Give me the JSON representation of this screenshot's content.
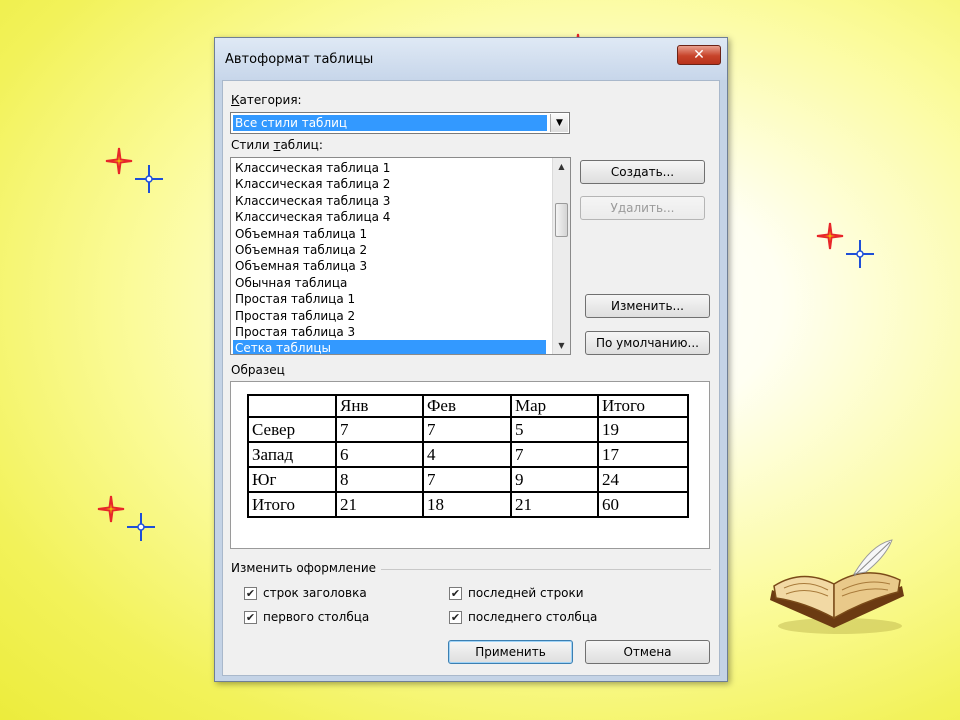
{
  "window": {
    "title": "Автоформат таблицы",
    "close_label": "✕"
  },
  "category": {
    "label_before": "",
    "label_underlined": "К",
    "label_after": "атегория:",
    "selected": "Все стили таблиц"
  },
  "styles": {
    "label_before": "Стили ",
    "label_underlined": "т",
    "label_after": "аблиц:",
    "items": [
      "Классическая таблица 1",
      "Классическая таблица 2",
      "Классическая таблица 3",
      "Классическая таблица 4",
      "Объемная таблица 1",
      "Объемная таблица 2",
      "Объемная таблица 3",
      "Обычная таблица",
      "Простая таблица 1",
      "Простая таблица 2",
      "Простая таблица 3",
      "Сетка таблицы"
    ],
    "selected_index": 11
  },
  "buttons": {
    "create": "Создать...",
    "delete": "Удалить...",
    "modify": "Изменить...",
    "default": "По умолчанию...",
    "apply": "Применить",
    "cancel": "Отмена"
  },
  "sample": {
    "label": "Образец",
    "header": [
      "",
      "Янв",
      "Фев",
      "Мар",
      "Итого"
    ],
    "rows": [
      [
        "Север",
        "7",
        "7",
        "5",
        "19"
      ],
      [
        "Запад",
        "6",
        "4",
        "7",
        "17"
      ],
      [
        "Юг",
        "8",
        "7",
        "9",
        "24"
      ],
      [
        "Итого",
        "21",
        "18",
        "21",
        "60"
      ]
    ]
  },
  "formatting": {
    "label": "Изменить оформление",
    "options": [
      {
        "label": "строк заголовка",
        "checked": true
      },
      {
        "label": "последней строки",
        "checked": true
      },
      {
        "label": "первого столбца",
        "checked": true
      },
      {
        "label": "последнего столбца",
        "checked": true
      }
    ]
  },
  "colors": {
    "selection": "#3399ff",
    "sparkle_red": "#e8262a",
    "sparkle_blue": "#1e4fd8"
  }
}
